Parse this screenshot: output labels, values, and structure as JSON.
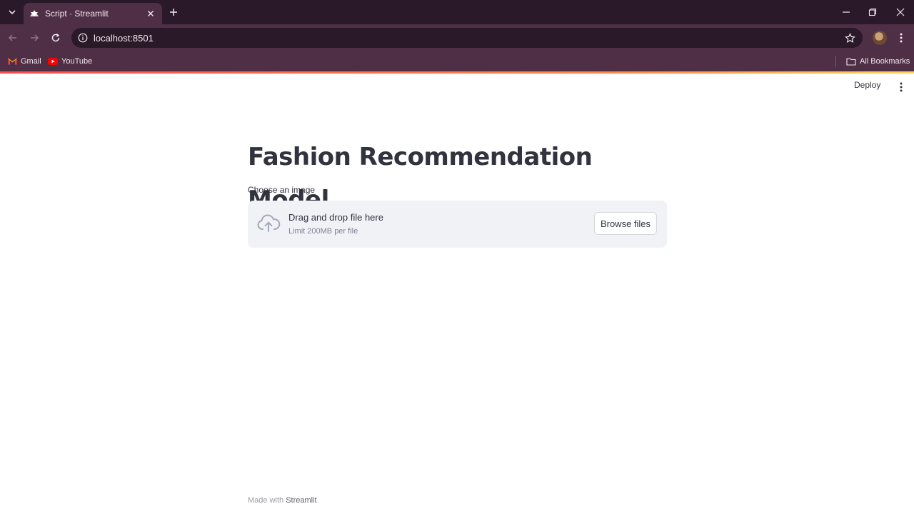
{
  "browser": {
    "tab_title": "Script · Streamlit",
    "url": "localhost:8501",
    "bookmarks": [
      {
        "label": "Gmail",
        "icon": "gmail-icon"
      },
      {
        "label": "YouTube",
        "icon": "youtube-icon"
      }
    ],
    "all_bookmarks_label": "All Bookmarks"
  },
  "streamlit": {
    "deploy_label": "Deploy",
    "title": "Fashion Recommendation Model",
    "uploader": {
      "label": "Choose an image",
      "drag_text": "Drag and drop file here",
      "limit_text": "Limit 200MB per file",
      "browse_label": "Browse files"
    },
    "footer": {
      "prefix": "Made with",
      "brand": "Streamlit"
    }
  },
  "colors": {
    "chrome_dark": "#2a1929",
    "chrome_mid": "#4f2f45",
    "text": "#31333f",
    "dropzone_bg": "#f0f2f6"
  }
}
